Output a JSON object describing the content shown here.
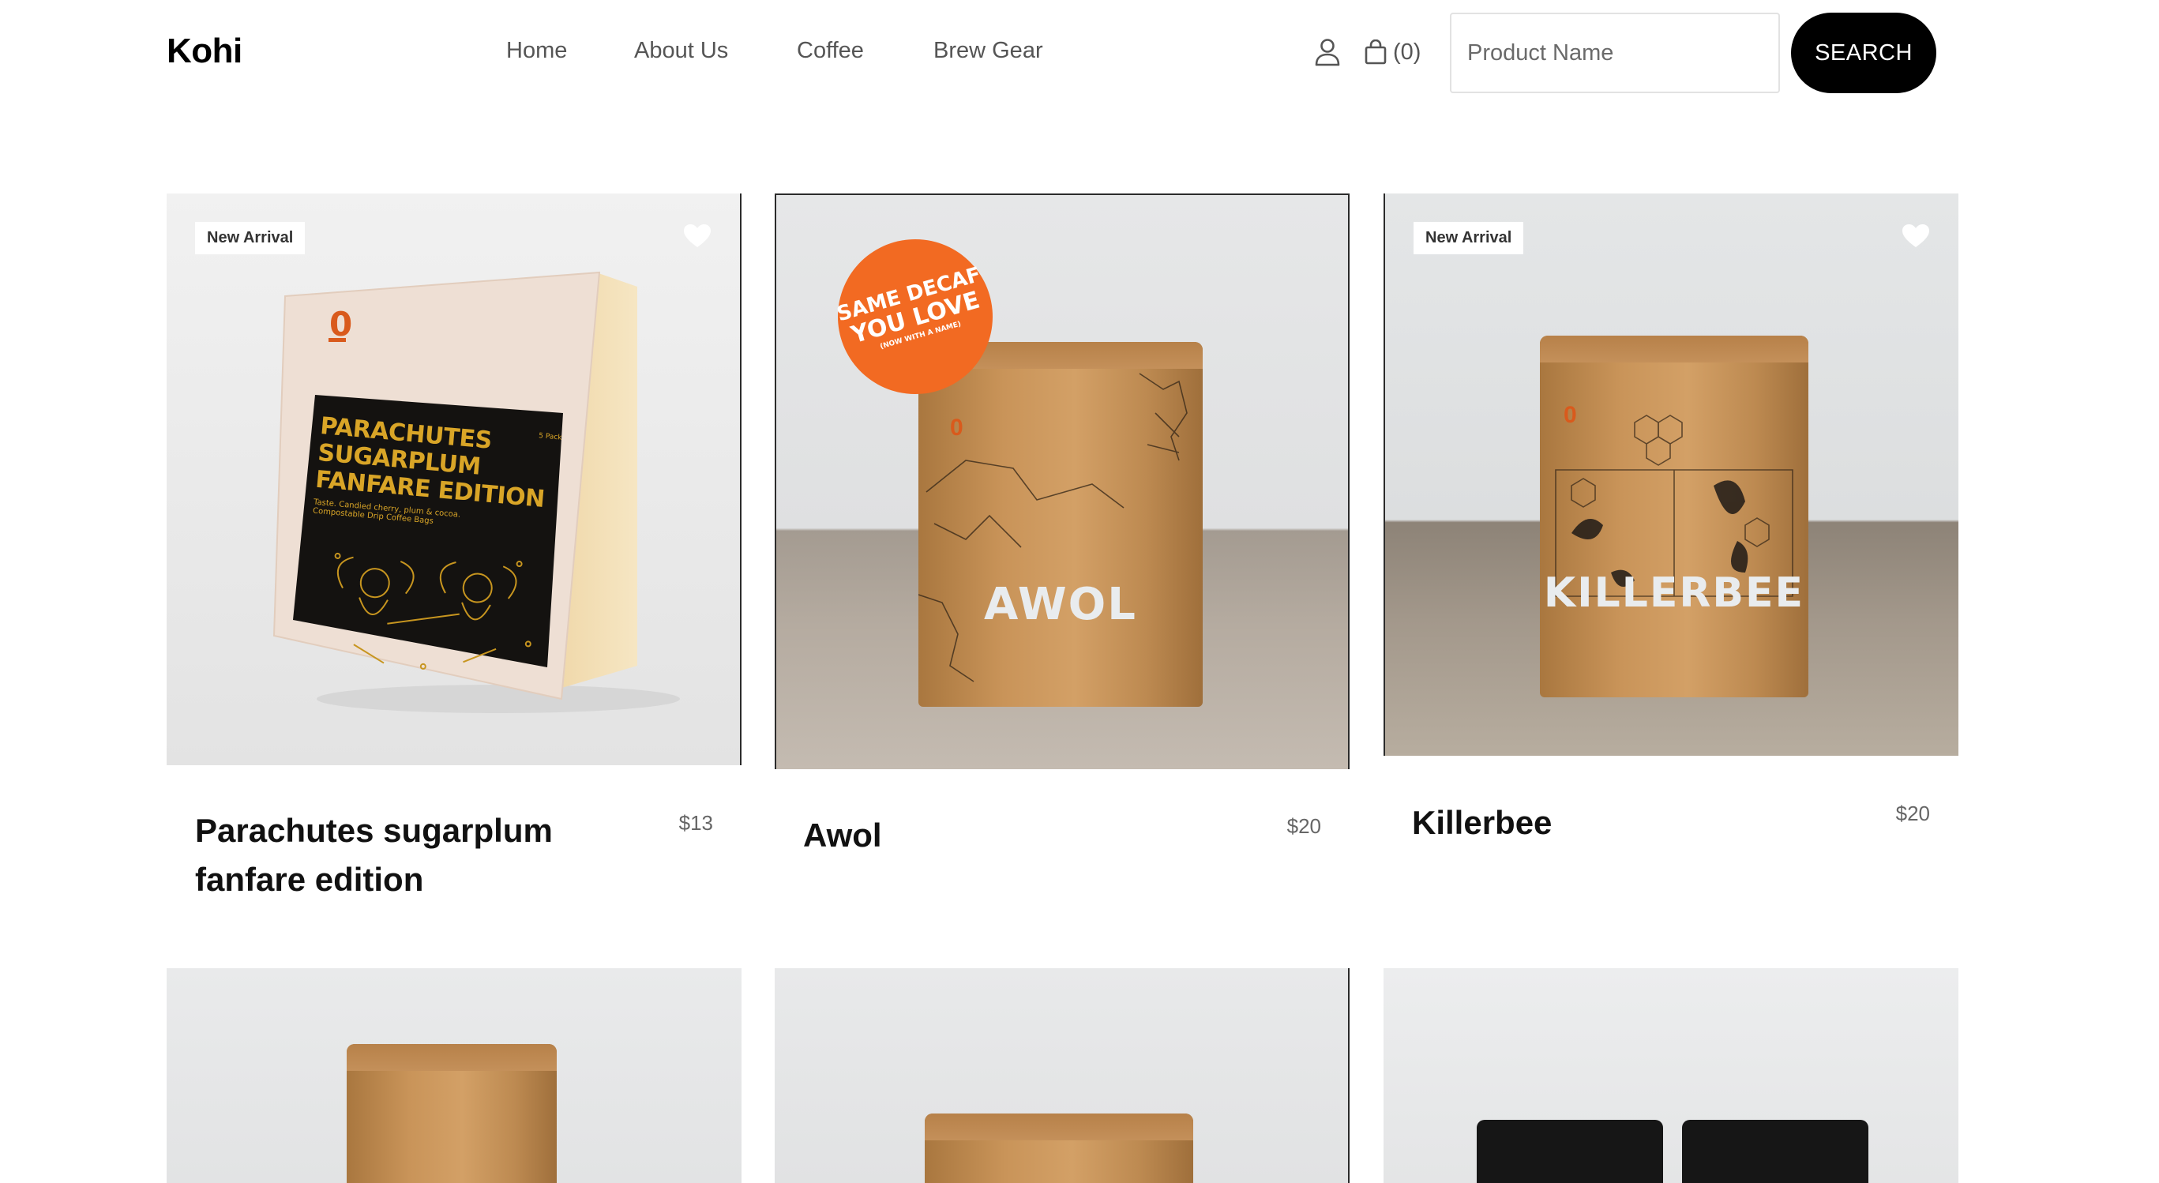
{
  "header": {
    "logo": "Kohi",
    "nav": [
      {
        "label": "Home"
      },
      {
        "label": "About Us"
      },
      {
        "label": "Coffee"
      },
      {
        "label": "Brew Gear"
      }
    ],
    "cart_count": "(0)",
    "search": {
      "placeholder": "Product Name",
      "button_label": "SEARCH"
    }
  },
  "products": [
    {
      "name": "Parachutes sugarplum fanfare edition",
      "price": "$13",
      "badge": "New Arrival",
      "art": {
        "label_lines": [
          "PARACHUTES",
          "SUGARPLUM",
          "FANFARE EDITION"
        ],
        "pack_size": "5 Pack",
        "tasting_note": "Taste. Candied cherry, plum & cocoa.",
        "format_note": "Compostable Drip Coffee Bags"
      }
    },
    {
      "name": "Awol",
      "price": "$20",
      "sticker": {
        "line1": "SAME DECAF",
        "line2": "YOU LOVE",
        "line3": "(NOW WITH A NAME)"
      },
      "art": {
        "bag_name": "AWOL"
      }
    },
    {
      "name": "Killerbee",
      "price": "$20",
      "badge": "New Arrival",
      "art": {
        "bag_name": "KILLERBEE"
      }
    },
    {
      "name": "",
      "price": ""
    },
    {
      "name": "",
      "price": ""
    },
    {
      "name": "",
      "price": ""
    }
  ],
  "colors": {
    "accent": "#000000",
    "sticker": "#f26a22",
    "brand_orange": "#d95a1c",
    "kraft": "#c99459"
  }
}
